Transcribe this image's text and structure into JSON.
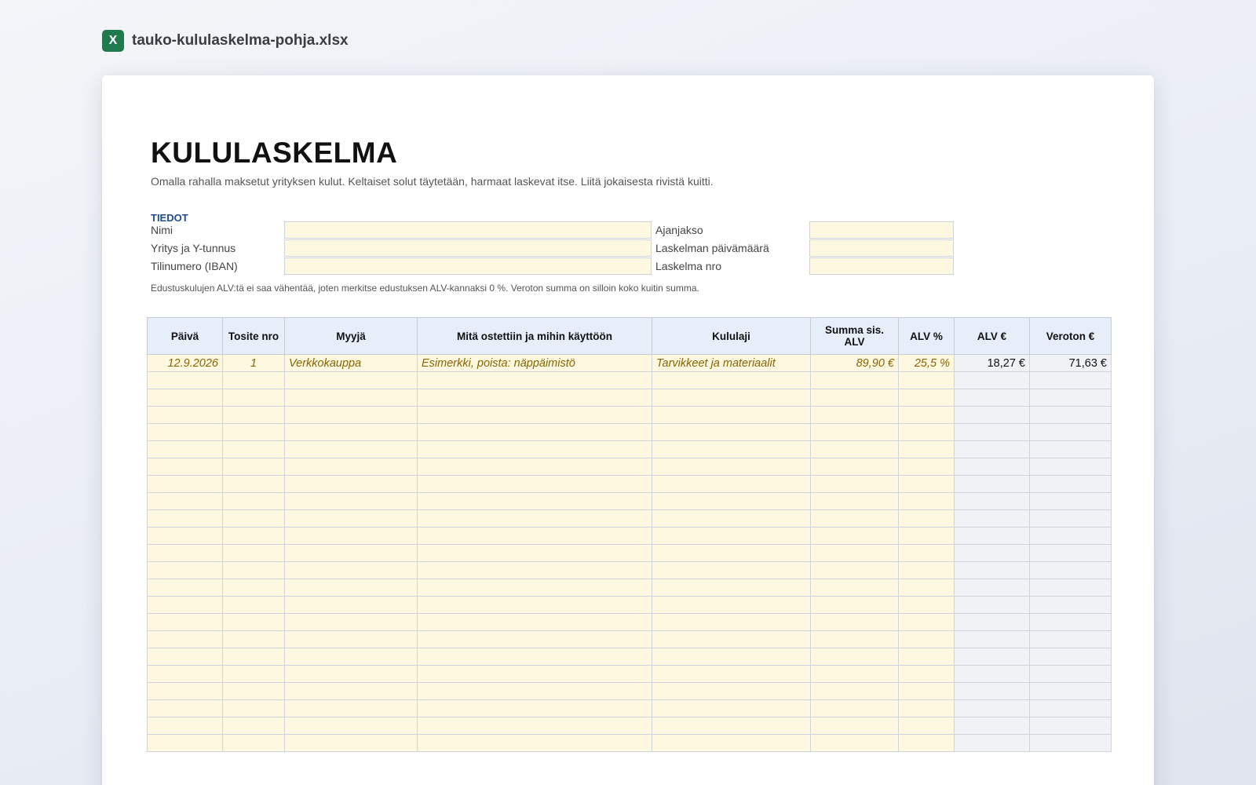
{
  "file": {
    "icon_letter": "X",
    "name": "tauko-kululaskelma-pohja.xlsx"
  },
  "document": {
    "title": "KULULASKELMA",
    "subtitle": "Omalla rahalla maksetut yrityksen kulut. Keltaiset solut täytetään, harmaat laskevat itse. Liitä jokaisesta rivistä kuitti."
  },
  "info": {
    "heading": "TIEDOT",
    "left_labels": [
      "Nimi",
      "Yritys ja Y-tunnus",
      "Tilinumero (IBAN)"
    ],
    "right_labels": [
      "Ajanjakso",
      "Laskelman päivämäärä",
      "Laskelma nro"
    ],
    "left_values": [
      "",
      "",
      ""
    ],
    "right_values": [
      "",
      "",
      ""
    ],
    "note": "Edustuskulujen ALV:tä ei saa vähentää, joten merkitse edustuksen ALV-kannaksi 0 %. Veroton summa on silloin koko kuitin summa."
  },
  "table": {
    "headers": [
      "Päivä",
      "Tosite nro",
      "Myyjä",
      "Mitä ostettiin ja mihin käyttöön",
      "Kululaji",
      "Summa sis. ALV",
      "ALV %",
      "ALV €",
      "Veroton €"
    ],
    "rows": [
      [
        "12.9.2026",
        "1",
        "Verkkokauppa",
        "Esimerkki, poista: näppäimistö",
        "Tarvikkeet ja materiaalit",
        "89,90 €",
        "25,5 %",
        "18,27 €",
        "71,63 €"
      ]
    ],
    "empty_rows": 22
  }
}
